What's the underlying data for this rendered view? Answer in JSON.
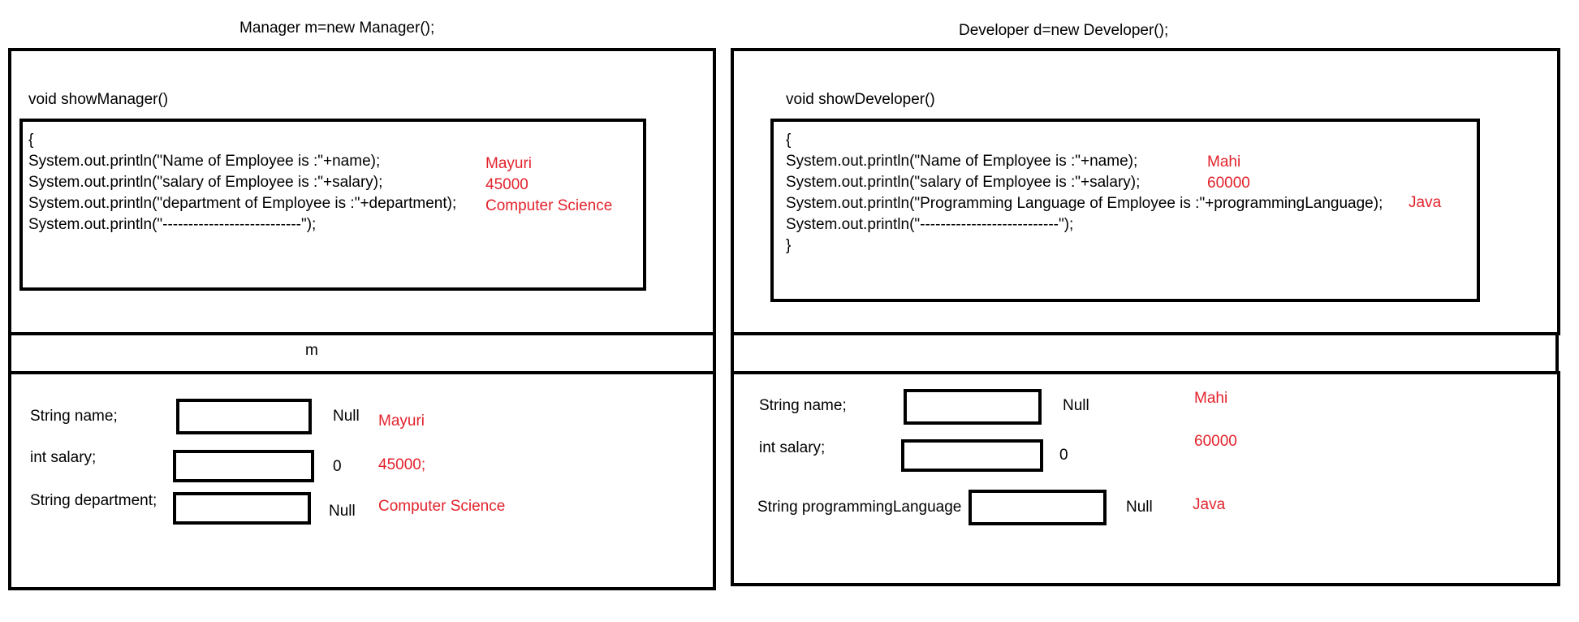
{
  "colors": {
    "annotation": "#e3232c",
    "stroke": "#000000"
  },
  "left": {
    "caption": "Manager m=new Manager();",
    "method_signature": "void showManager()",
    "code_lines": [
      "{",
      "System.out.println(\"Name of Employee is :\"+name);",
      "System.out.println(\"salary of Employee is :\"+salary);",
      "System.out.println(\"department of Employee is :\"+department);",
      "System.out.println(\"---------------------------\");"
    ],
    "code_values": [
      "Mayuri",
      "45000",
      "Computer Science"
    ],
    "reference_label": "m",
    "fields": [
      {
        "label": "String name;",
        "default": "Null",
        "value": "Mayuri"
      },
      {
        "label": "int salary;",
        "default": "0",
        "value": "45000;"
      },
      {
        "label": "String department;",
        "default": "Null",
        "value": "Computer Science"
      }
    ]
  },
  "right": {
    "caption": "Developer d=new Developer();",
    "method_signature": "void showDeveloper()",
    "code_lines": [
      "{",
      "System.out.println(\"Name of Employee is :\"+name);",
      "System.out.println(\"salary of Employee is :\"+salary);",
      "System.out.println(\"Programming Language of Employee is :\"+programmingLanguage);",
      "System.out.println(\"---------------------------\");",
      "}"
    ],
    "code_values": [
      "Mahi",
      "60000",
      "Java"
    ],
    "reference_label": "",
    "fields": [
      {
        "label": "String name;",
        "default": "Null",
        "value": "Mahi"
      },
      {
        "label": "int salary;",
        "default": "0",
        "value": "60000"
      },
      {
        "label": "String programmingLanguage",
        "default": "Null",
        "value": "Java"
      }
    ]
  }
}
